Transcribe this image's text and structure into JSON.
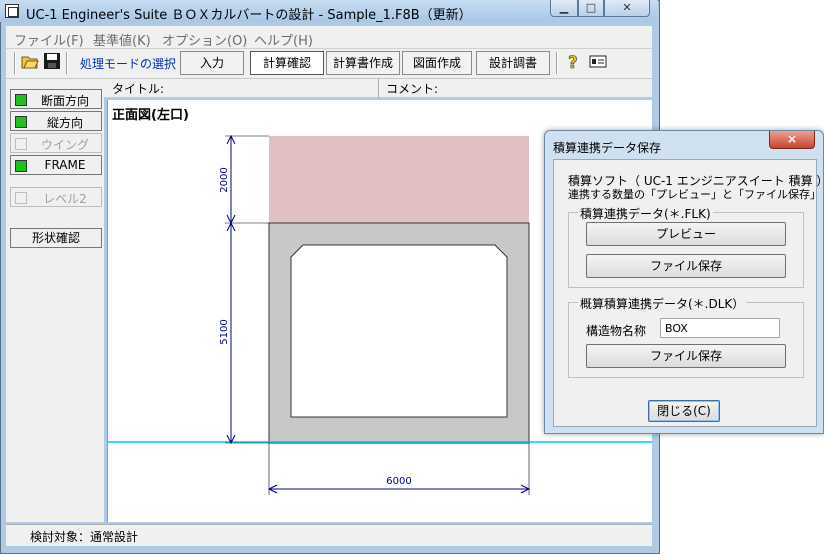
{
  "window": {
    "title": "UC-1 Engineer's Suite ＢＯＸカルバートの設計 - Sample_1.F8B（更新）"
  },
  "menu": [
    "ファイル(F)",
    "基準値(K)",
    "オプション(O)",
    "ヘルプ(H)"
  ],
  "toolbar": {
    "mode_label": "処理モードの選択",
    "tabs": [
      "入力",
      "計算確認",
      "計算書作成",
      "図面作成",
      "設計調書"
    ],
    "active_tab": "計算確認"
  },
  "infobar": {
    "title_label": "タイトル:",
    "comment_label": "コメント:"
  },
  "side_buttons": [
    {
      "label": "断面方向",
      "enabled": true
    },
    {
      "label": "縦方向",
      "enabled": true
    },
    {
      "label": "ウイング",
      "enabled": false
    },
    {
      "label": "FRAME",
      "enabled": true
    },
    {
      "label": "レベル2",
      "enabled": false
    }
  ],
  "shape_check_label": "形状確認",
  "drawing": {
    "view_title": "正面図(左口)",
    "dim_top": "2000",
    "dim_height": "5100",
    "dim_width": "6000",
    "colors": {
      "fill": "#e0c0c2",
      "concrete": "#c8c8c8",
      "ground": "#00c8e6",
      "dimension": "#00008b"
    }
  },
  "status": {
    "text": "検討対象：通常設計"
  },
  "dialog": {
    "title": "積算連携データ保存",
    "close_icon": "×",
    "desc_line1": "積算ソフト（ UC-1 エンジニアスイート 積算 ）へ",
    "desc_line2": "連携する数量の「プレビュー」と「ファイル保存」",
    "group1_title": "積算連携データ(＊.FLK)",
    "preview_button": "プレビュー",
    "file_save_button1": "ファイル保存",
    "group2_title": "概算積算連携データ(＊.DLK）",
    "struct_name_label": "構造物名称",
    "struct_name_value": "BOX",
    "file_save_button2": "ファイル保存",
    "close_button": "閉じる(C)"
  }
}
